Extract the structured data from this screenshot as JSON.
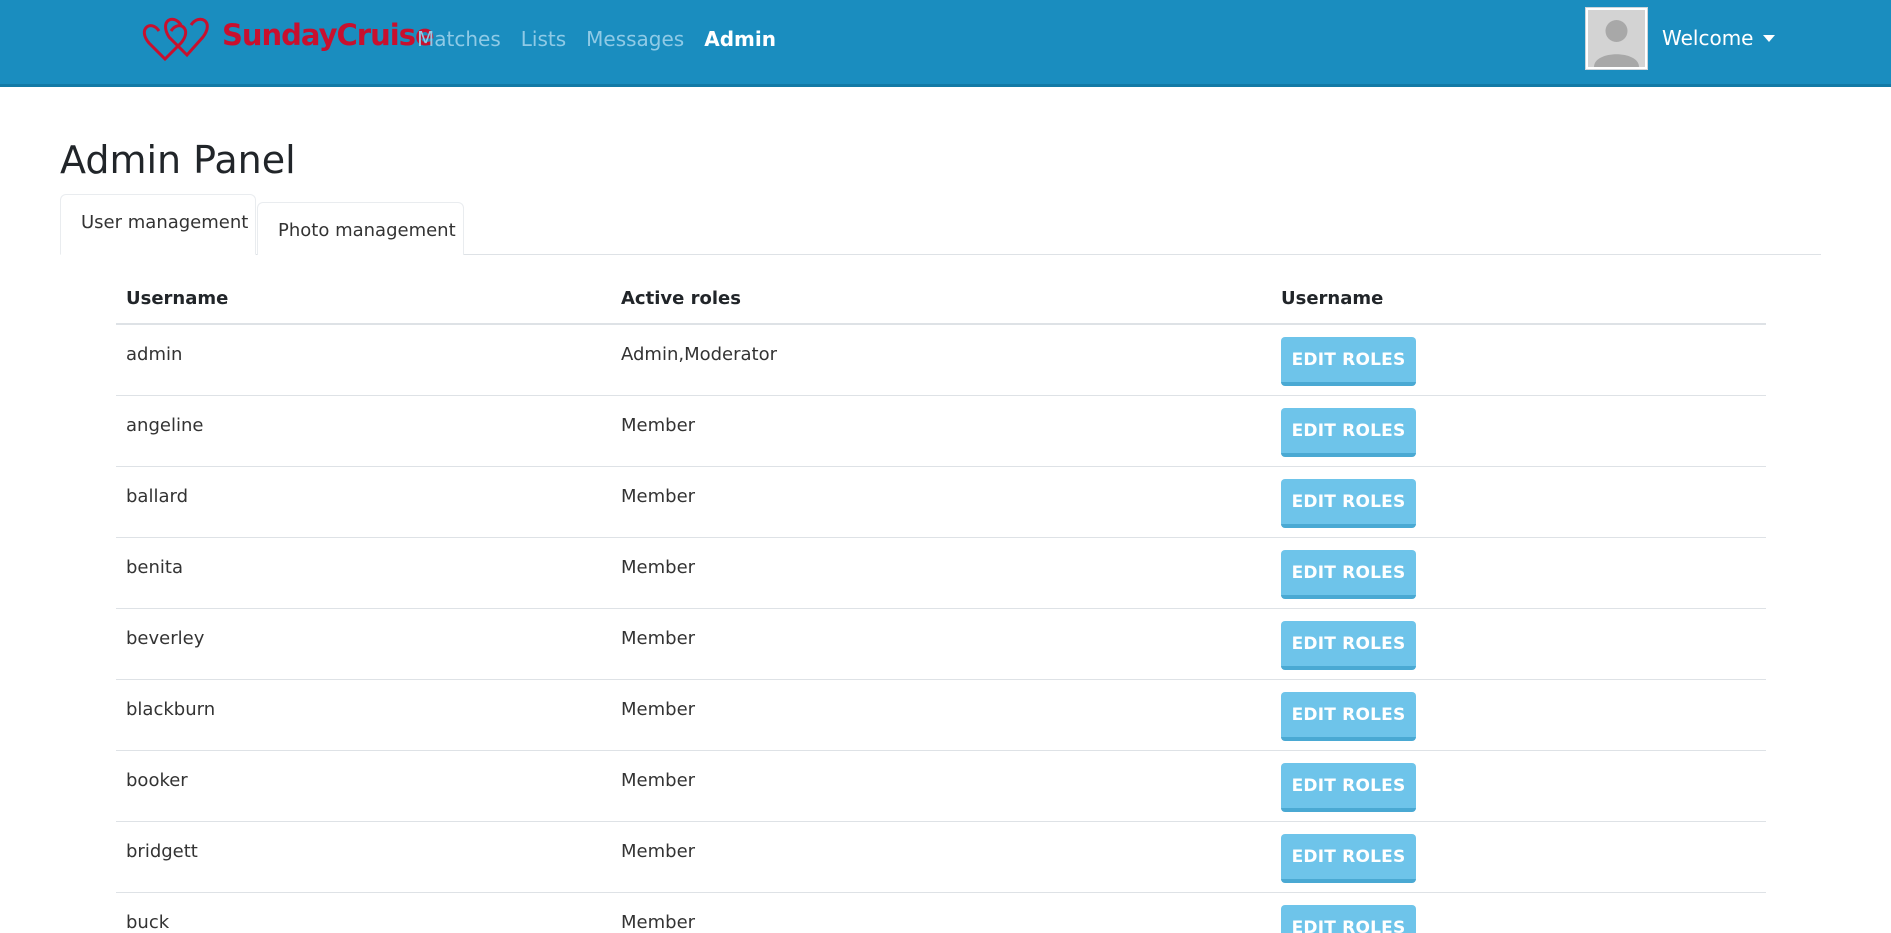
{
  "navbar": {
    "brand": "SundayCruise",
    "links": [
      {
        "label": "Matches",
        "active": false
      },
      {
        "label": "Lists",
        "active": false
      },
      {
        "label": "Messages",
        "active": false
      },
      {
        "label": "Admin",
        "active": true
      }
    ],
    "welcome": "Welcome",
    "colors": {
      "background": "#1a8dbf",
      "brand": "#c8102e"
    }
  },
  "page": {
    "title": "Admin Panel",
    "tabs": [
      {
        "label": "User management",
        "active": true
      },
      {
        "label": "Photo management",
        "active": false
      }
    ]
  },
  "table": {
    "headers": [
      "Username",
      "Active roles",
      "Username"
    ],
    "rows": [
      {
        "username": "admin",
        "roles": "Admin,Moderator",
        "action": "EDIT ROLES"
      },
      {
        "username": "angeline",
        "roles": "Member",
        "action": "EDIT ROLES"
      },
      {
        "username": "ballard",
        "roles": "Member",
        "action": "EDIT ROLES"
      },
      {
        "username": "benita",
        "roles": "Member",
        "action": "EDIT ROLES"
      },
      {
        "username": "beverley",
        "roles": "Member",
        "action": "EDIT ROLES"
      },
      {
        "username": "blackburn",
        "roles": "Member",
        "action": "EDIT ROLES"
      },
      {
        "username": "booker",
        "roles": "Member",
        "action": "EDIT ROLES"
      },
      {
        "username": "bridgett",
        "roles": "Member",
        "action": "EDIT ROLES"
      },
      {
        "username": "buck",
        "roles": "Member",
        "action": "EDIT ROLES"
      }
    ],
    "button_color": "#6ec4ea"
  }
}
